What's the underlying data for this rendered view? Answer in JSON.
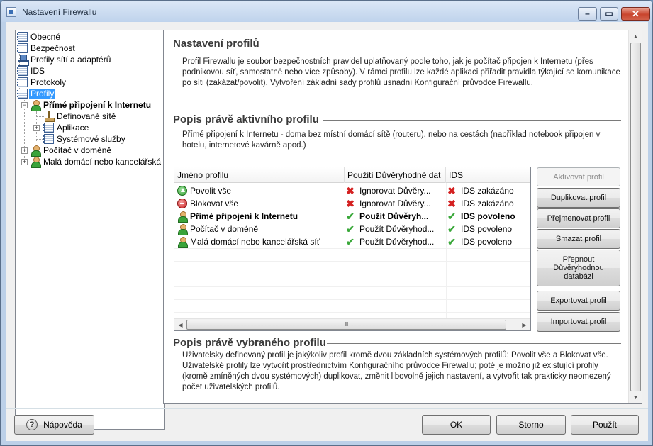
{
  "window": {
    "title": "Nastavení Firewallu"
  },
  "tree": {
    "items": [
      {
        "label": "Obecné"
      },
      {
        "label": "Bezpečnost"
      },
      {
        "label": "Profily sítí a adaptérů"
      },
      {
        "label": "IDS"
      },
      {
        "label": "Protokoly"
      },
      {
        "label": "Profily"
      },
      {
        "label": "Přímé připojení k Internetu"
      },
      {
        "label": "Definované sítě"
      },
      {
        "label": "Aplikace"
      },
      {
        "label": "Systémové služby"
      },
      {
        "label": "Počítač v doméně"
      },
      {
        "label": "Malá domácí nebo kancelářská síť"
      }
    ]
  },
  "main": {
    "section1_title": "Nastavení profilů",
    "section1_text": "Profil Firewallu je soubor bezpečnostních pravidel uplatňovaný podle toho, jak je počítač připojen k Internetu (přes podnikovou síť, samostatně nebo více způsoby). V rámci profilu lze každé aplikaci přiřadit pravidla týkající se komunikace po síti (zakázat/povolit). Vytvoření základní sady profilů usnadní Konfigurační průvodce Firewallu.",
    "section2_title": "Popis právě aktivního profilu",
    "section2_text": "Přímé připojení k Internetu - doma bez místní domácí sítě (routeru), nebo na cestách (například notebook připojen v hotelu, internetové kavárně apod.)",
    "section3_title": "Popis právě vybraného profilu",
    "section3_text": "Uživatelsky definovaný profil je jakýkoliv profil kromě dvou základních systémových profilů: Povolit vše a Blokovat vše. Uživatelské profily lze vytvořit prostřednictvím Konfiguračního průvodce Firewallu; poté je možno již existující profily (kromě zmíněných dvou systémových) duplikovat, změnit libovolně jejich nastavení, a vytvořit tak prakticky neomezený počet uživatelských profilů."
  },
  "profiles_table": {
    "columns": [
      "Jméno profilu",
      "Použití Důvěryhodné dat",
      "IDS"
    ],
    "rows": [
      {
        "name": "Povolit vše",
        "trusted": "Ignorovat Důvěry...",
        "ids": "IDS zakázáno"
      },
      {
        "name": "Blokovat vše",
        "trusted": "Ignorovat Důvěry...",
        "ids": "IDS zakázáno"
      },
      {
        "name": "Přímé připojení k Internetu",
        "trusted": "Použít Důvěryh...",
        "ids": "IDS povoleno"
      },
      {
        "name": "Počítač v doméně",
        "trusted": "Použít Důvěryhod...",
        "ids": "IDS povoleno"
      },
      {
        "name": "Malá domácí nebo kancelářská síť",
        "trusted": "Použít Důvěryhod...",
        "ids": "IDS povoleno"
      }
    ],
    "scroll_glyph": "III"
  },
  "side_buttons": {
    "activate": "Aktivovat profil",
    "duplicate": "Duplikovat profil",
    "rename": "Přejmenovat profil",
    "delete": "Smazat profil",
    "switch_db": "Přepnout Důvěryhodnou databázi",
    "export": "Exportovat profil",
    "import": "Importovat profil"
  },
  "footer": {
    "help": "Nápověda",
    "ok": "OK",
    "cancel": "Storno",
    "apply": "Použít"
  },
  "glyphs": {
    "min": "–",
    "max": "▭",
    "close": "✕",
    "check": "✔",
    "cross": "✖",
    "help": "?"
  }
}
